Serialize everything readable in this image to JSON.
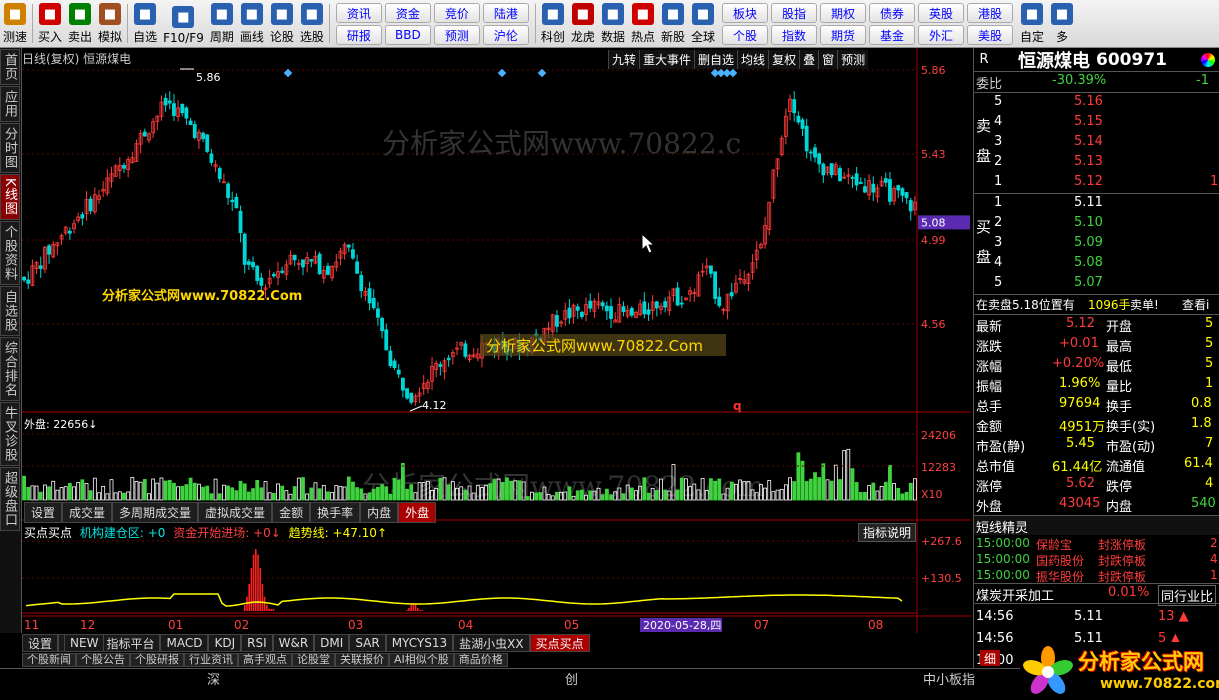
{
  "toolbar": {
    "items": [
      {
        "label": "测速",
        "icon": "clock-icon",
        "color": "#d08000"
      },
      {
        "label": "买入",
        "icon": "buy-icon",
        "color": "#d00000"
      },
      {
        "label": "卖出",
        "icon": "sell-icon",
        "color": "#008000"
      },
      {
        "label": "模拟",
        "icon": "hammer-icon",
        "color": "#a05020"
      },
      {
        "label": "自选",
        "icon": "star-icon",
        "color": "#2a60b0"
      },
      {
        "label": "F10/F9",
        "icon": "f10-icon",
        "color": "#2a60b0"
      },
      {
        "label": "周期",
        "icon": "cycle-icon",
        "color": "#2a60b0"
      },
      {
        "label": "画线",
        "icon": "pen-icon",
        "color": "#2a60b0"
      },
      {
        "label": "论股",
        "icon": "discuss-icon",
        "color": "#2a60b0"
      },
      {
        "label": "选股",
        "icon": "select-icon",
        "color": "#2a60b0"
      }
    ],
    "grid1": [
      "资讯",
      "资金",
      "竞价",
      "陆港",
      "研报",
      "BBD",
      "预测",
      "沪伦"
    ],
    "items2": [
      {
        "label": "科创",
        "icon": "kechuang-icon",
        "color": "#2a60b0"
      },
      {
        "label": "龙虎",
        "icon": "tiger-icon",
        "color": "#c00000"
      },
      {
        "label": "数据",
        "icon": "pe-icon",
        "color": "#2a60b0"
      },
      {
        "label": "热点",
        "icon": "hot-icon",
        "color": "#d00000"
      },
      {
        "label": "新股",
        "icon": "ipo-icon",
        "color": "#2a60b0"
      },
      {
        "label": "全球",
        "icon": "globe-icon",
        "color": "#2a60b0"
      }
    ],
    "grid2": [
      "板块",
      "股指",
      "期权",
      "债券",
      "英股",
      "港股",
      "个股",
      "指数",
      "期货",
      "基金",
      "外汇",
      "美股"
    ],
    "items3": [
      {
        "label": "自定",
        "icon": "custom-icon",
        "color": "#2a60b0"
      },
      {
        "label": "多",
        "icon": "multi-icon",
        "color": "#2a60b0"
      }
    ]
  },
  "left_tabs": [
    {
      "label": "首页",
      "active": false
    },
    {
      "label": "应用",
      "active": false
    },
    {
      "label": "分时图",
      "active": false
    },
    {
      "label": "K线图",
      "active": true
    },
    {
      "label": "个股资料",
      "active": false
    },
    {
      "label": "自选股",
      "active": false
    },
    {
      "label": "综合排名",
      "active": false
    },
    {
      "label": "牛叉诊股",
      "active": false
    },
    {
      "label": "超级盘口",
      "active": false
    }
  ],
  "chart": {
    "header": "日线(复权) 恒源煤电",
    "tools": [
      "九转",
      "重大事件",
      "删自选",
      "均线",
      "复权",
      "叠",
      "窗",
      "预测"
    ],
    "watermark1": "分析家公式网www.70822.com",
    "watermark_big": "分析家公式网www.70822.c",
    "watermark_center": "分析家公式网www.70822.Com",
    "watermark_left": "分析家公式网www.70822.Com",
    "high_label": "5.86",
    "low_label": "4.12",
    "price_axis": [
      "5.86",
      "5.43",
      "4.99",
      "4.56"
    ],
    "current_price": "5.08",
    "volume_label": "外盘: 22656↓",
    "volume_axis": [
      "24206",
      "12283"
    ],
    "volume_multiplier": "X10",
    "sub_tabs": [
      "设置",
      "成交量",
      "多周期成交量",
      "虚拟成交量",
      "金额",
      "换手率",
      "内盘",
      "外盘"
    ],
    "sub_tab_active": "外盘",
    "ind2": {
      "name": "买点买点",
      "p1": "机构建仓区: +0",
      "p2": "资金开始进场: +0↓",
      "p3": "趋势线: +47.10↑"
    },
    "ind2_axis": [
      "+267.6",
      "+130.5"
    ],
    "help_button": "指标说明",
    "x_labels": [
      "11",
      "12",
      "01",
      "02",
      "03",
      "04",
      "05",
      "06",
      "07",
      "08"
    ],
    "cursor_date": "2020-05-28,四",
    "q_marker": "q"
  },
  "bottom_tabs": [
    "设置",
    "指标平台",
    "MACD",
    "KDJ",
    "RSI",
    "W&R",
    "DMI",
    "SAR",
    "MYCYS13",
    "盐湖小虫XX",
    "买点买点"
  ],
  "bottom_tab_active": "买点买点",
  "bottom_tabs2": [
    "个股新闻",
    "个股公告",
    "个股研报",
    "行业资讯",
    "高手观点",
    "论股堂",
    "关联报价",
    "AI相似个股",
    "商品价格"
  ],
  "status_bar": {
    "c1": "深",
    "c2": "创",
    "c3": "中小板指"
  },
  "quote": {
    "market": "R",
    "name": "恒源煤电",
    "code": "600971",
    "weibi_label": "委比",
    "weibi": "-30.39%",
    "weibi2": "-1",
    "sell_label": "卖盘",
    "buy_label": "买盘",
    "sells": [
      {
        "lvl": "5",
        "price": "5.16"
      },
      {
        "lvl": "4",
        "price": "5.15"
      },
      {
        "lvl": "3",
        "price": "5.14"
      },
      {
        "lvl": "2",
        "price": "5.13"
      },
      {
        "lvl": "1",
        "price": "5.12",
        "vol": "1"
      }
    ],
    "buys": [
      {
        "lvl": "1",
        "price": "5.11"
      },
      {
        "lvl": "2",
        "price": "5.10"
      },
      {
        "lvl": "3",
        "price": "5.09"
      },
      {
        "lvl": "4",
        "price": "5.08"
      },
      {
        "lvl": "5",
        "price": "5.07"
      }
    ],
    "inplace": "在卖盘5.18位置有",
    "inplace_vol": "1096手",
    "inplace_act": "卖单!",
    "inplace_btn": "查看i",
    "stats": [
      {
        "k1": "最新",
        "v1": "5.12",
        "k2": "开盘",
        "v2": "5"
      },
      {
        "k1": "涨跌",
        "v1": "+0.01",
        "k2": "最高",
        "v2": "5"
      },
      {
        "k1": "涨幅",
        "v1": "+0.20%",
        "k2": "最低",
        "v2": "5"
      },
      {
        "k1": "振幅",
        "v1": "1.96%",
        "k2": "量比",
        "v2": "1"
      },
      {
        "k1": "总手",
        "v1": "97694",
        "k2": "换手",
        "v2": "0.8"
      },
      {
        "k1": "金额",
        "v1": "4951万",
        "k2": "换手(实)",
        "v2": "1.8"
      },
      {
        "k1": "市盈(静)",
        "v1": "5.45",
        "k2": "市盈(动)",
        "v2": "7"
      },
      {
        "k1": "总市值",
        "v1": "61.44亿",
        "k2": "流通值",
        "v2": "61.4"
      },
      {
        "k1": "涨停",
        "v1": "5.62",
        "k2": "跌停",
        "v2": "4"
      },
      {
        "k1": "外盘",
        "v1": "43045",
        "k2": "内盘",
        "v2": "540"
      }
    ],
    "sprite_title": "短线精灵",
    "sprite": [
      {
        "t": "15:00:00",
        "n": "保龄宝",
        "a": "封涨停板",
        "v": "2"
      },
      {
        "t": "15:00:00",
        "n": "国药股份",
        "a": "封跌停板",
        "v": "4"
      },
      {
        "t": "15:00:00",
        "n": "振华股份",
        "a": "封跌停板",
        "v": "1"
      }
    ],
    "industry": "煤炭开采加工",
    "industry_pct": "0.01%",
    "industry_btn": "同行业比",
    "ticks": [
      {
        "t": "14:56",
        "p": "5.11",
        "v": "13"
      },
      {
        "t": "14:56",
        "p": "5.11",
        "v": "5"
      },
      {
        "t": "15:00",
        "p": "5.12",
        "v": "863"
      }
    ],
    "detail_tab": "细"
  },
  "brand": {
    "name": "分析家公式网",
    "url": "www.70822.com"
  },
  "colors": {
    "up": "#ff3b3b",
    "down": "#00d6d6",
    "volume_up": "#ffffff",
    "volume_down": "#3fd33f",
    "trend": "#ffff00",
    "signal": "#ff2020"
  }
}
